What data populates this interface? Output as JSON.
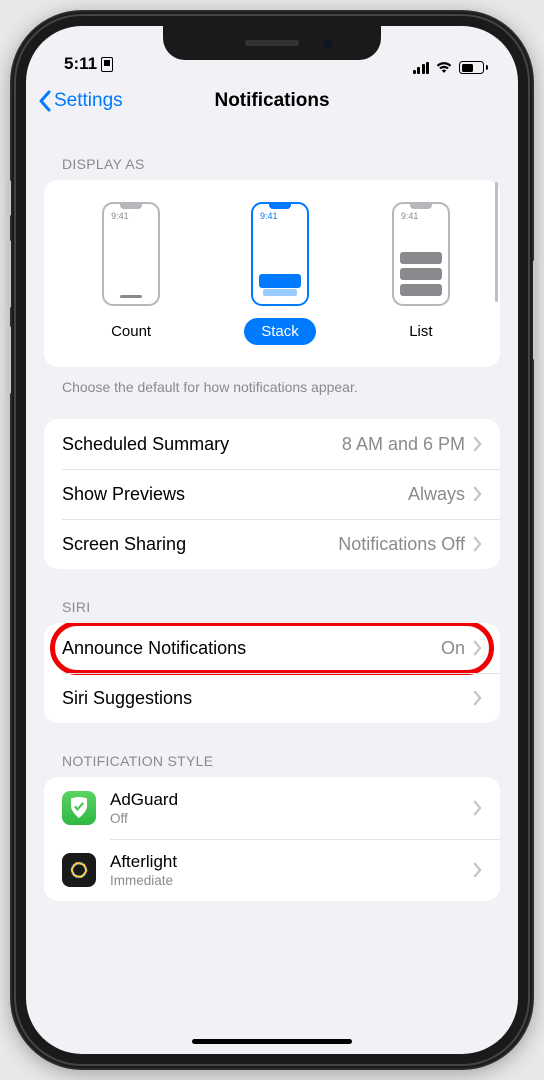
{
  "status": {
    "time": "5:11"
  },
  "nav": {
    "back": "Settings",
    "title": "Notifications"
  },
  "sections": {
    "displayAs": {
      "header": "DISPLAY AS",
      "options": {
        "count": "Count",
        "stack": "Stack",
        "list": "List"
      },
      "miniTime": "9:41",
      "footer": "Choose the default for how notifications appear."
    },
    "general": {
      "rows": {
        "scheduled": {
          "label": "Scheduled Summary",
          "value": "8 AM and 6 PM"
        },
        "previews": {
          "label": "Show Previews",
          "value": "Always"
        },
        "sharing": {
          "label": "Screen Sharing",
          "value": "Notifications Off"
        }
      }
    },
    "siri": {
      "header": "SIRI",
      "rows": {
        "announce": {
          "label": "Announce Notifications",
          "value": "On"
        },
        "suggestions": {
          "label": "Siri Suggestions"
        }
      }
    },
    "style": {
      "header": "NOTIFICATION STYLE",
      "apps": {
        "adguard": {
          "name": "AdGuard",
          "sub": "Off"
        },
        "afterlight": {
          "name": "Afterlight",
          "sub": "Immediate"
        }
      }
    }
  }
}
